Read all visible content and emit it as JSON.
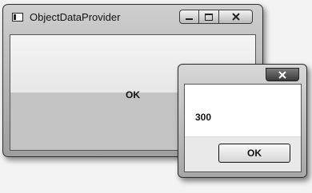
{
  "main_window": {
    "title": "ObjectDataProvider",
    "button_label": "OK"
  },
  "message_box": {
    "message": "300",
    "ok_label": "OK"
  },
  "icons": {
    "app": "window-app-icon",
    "minimize": "minimize-icon",
    "maximize": "maximize-icon",
    "close": "close-icon"
  }
}
